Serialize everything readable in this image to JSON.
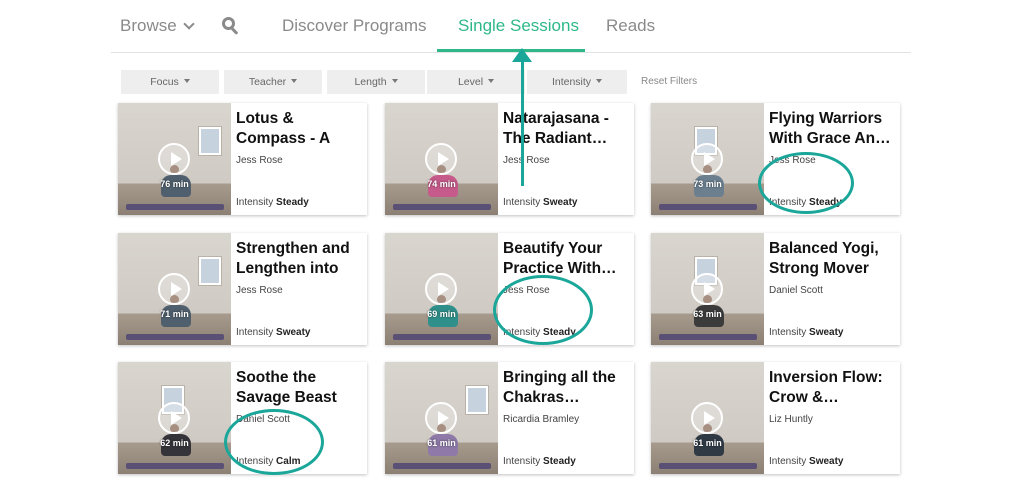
{
  "nav": {
    "browse": "Browse",
    "discover": "Discover Programs",
    "single": "Single Sessions",
    "reads": "Reads",
    "search_icon": "search-icon"
  },
  "filters": {
    "focus": "Focus",
    "teacher": "Teacher",
    "length": "Length",
    "level": "Level",
    "intensity": "Intensity",
    "reset": "Reset Filters"
  },
  "intensity_label": "Intensity",
  "cards": [
    {
      "title": "Lotus & Compass - A Match Mad…",
      "teacher": "Jess Rose",
      "minutes": "76 min",
      "intensity": "Steady"
    },
    {
      "title": "Natarajasana - The Radiant…",
      "teacher": "Jess Rose",
      "minutes": "74 min",
      "intensity": "Sweaty"
    },
    {
      "title": "Flying Warriors With Grace An…",
      "teacher": "Jess Rose",
      "minutes": "73 min",
      "intensity": "Steady"
    },
    {
      "title": "Strengthen and Lengthen into a…",
      "teacher": "Jess Rose",
      "minutes": "71 min",
      "intensity": "Sweaty"
    },
    {
      "title": "Beautify Your Practice With…",
      "teacher": "Jess Rose",
      "minutes": "69 min",
      "intensity": "Steady"
    },
    {
      "title": "Balanced Yogi, Strong Mover",
      "teacher": "Daniel Scott",
      "minutes": "63 min",
      "intensity": "Sweaty"
    },
    {
      "title": "Soothe the Savage Beast",
      "teacher": "Daniel Scott",
      "minutes": "62 min",
      "intensity": "Calm"
    },
    {
      "title": "Bringing all the Chakras…",
      "teacher": "Ricardia Bramley",
      "minutes": "61 min",
      "intensity": "Steady"
    },
    {
      "title": "Inversion Flow: Crow &…",
      "teacher": "Liz Huntly",
      "minutes": "61 min",
      "intensity": "Sweaty"
    }
  ],
  "colors": {
    "accent": "#2eb88a",
    "annotation": "#1aa79a"
  }
}
